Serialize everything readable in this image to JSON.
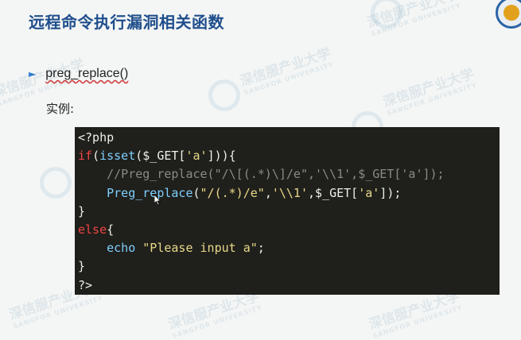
{
  "title": "远程命令执行漏洞相关函数",
  "bullet": {
    "text": "preg_replace()"
  },
  "example_label": "实例:",
  "watermark": {
    "text": "深信服产业大学",
    "sub": "SANGFOR UNIVERSITY"
  },
  "code": {
    "lines": [
      "<?php",
      "if(isset($_GET['a'])){",
      "    //Preg_replace(\"/\\[(.*)\\]/e\",'\\\\1',$_GET['a']);",
      "    Preg_replace(\"/(.*)/e\",'\\\\1',$_GET['a']);",
      "}",
      "else{",
      "    echo \"Please input a\";",
      "}",
      "?>"
    ]
  },
  "colors": {
    "title": "#1f4e8c",
    "bullet_arrow": "#2f7fd0",
    "code_background": "#1f1f1b",
    "keyword": "#ef4545",
    "function": "#7fd0ff",
    "string": "#e9d98a",
    "comment": "#8a8a86"
  },
  "icons": {
    "bullet": "triangle-right-icon",
    "cursor": "mouse-pointer-icon",
    "logo": "sangfor-logo"
  }
}
